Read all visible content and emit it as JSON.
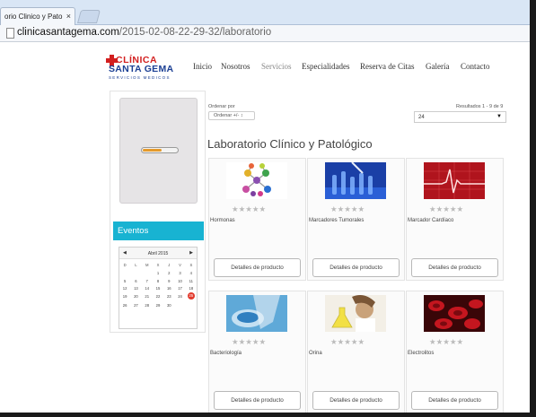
{
  "browser": {
    "tab_title": "orio Clinico y Pato",
    "tab_close": "×",
    "url_host": "clinicasantagema.com",
    "url_path": "/2015-02-08-22-29-32/laboratorio"
  },
  "logo": {
    "line1": "CLÍNICA",
    "line2": "SANTA GEMA",
    "line3": "SERVICIOS MEDICOS",
    "colors": {
      "red": "#d21f1f",
      "blue": "#1b3f94"
    }
  },
  "nav": {
    "items": [
      "Inicio",
      "Nosotros",
      "Servicios",
      "Especialidades",
      "Reserva de Citas",
      "Galería",
      "Contacto"
    ],
    "active": "Servicios"
  },
  "sidebar": {
    "loader_progress": 0.55,
    "events_title": "Eventos",
    "calendar": {
      "month": "Abril 2015",
      "prev": "◀",
      "next": "▶",
      "weekdays": [
        "D",
        "L",
        "M",
        "X",
        "J",
        "V",
        "S"
      ],
      "weeks": [
        [
          "",
          "",
          "",
          "1",
          "2",
          "3",
          "4"
        ],
        [
          "5",
          "6",
          "7",
          "8",
          "9",
          "10",
          "11"
        ],
        [
          "12",
          "13",
          "14",
          "15",
          "16",
          "17",
          "18"
        ],
        [
          "19",
          "20",
          "21",
          "22",
          "23",
          "24",
          "25"
        ],
        [
          "26",
          "27",
          "28",
          "29",
          "30",
          "",
          ""
        ]
      ],
      "today": "25"
    }
  },
  "toolbar": {
    "order_label": "Ordenar por",
    "order_value": "Ordenar +/-",
    "order_icon": "↕",
    "results": "Resultados 1 - 9 de 9",
    "per_page": "24",
    "per_page_arrow": "▼"
  },
  "page_title": "Laboratorio Clínico y Patológico",
  "rating_stars": "★★★★★",
  "products": [
    {
      "name": "Hormonas",
      "button": "Detalles de producto",
      "image": "hormones-molecule"
    },
    {
      "name": "Marcadores Tumorales",
      "button": "Detalles de producto",
      "image": "test-tubes"
    },
    {
      "name": "Marcador Cardíaco",
      "button": "Detalles de producto",
      "image": "heartbeat"
    },
    {
      "name": "Bacteriología",
      "button": "Detalles de producto",
      "image": "petri-dish"
    },
    {
      "name": "Orina",
      "button": "Detalles de producto",
      "image": "scientist-flask"
    },
    {
      "name": "Electrolitos",
      "button": "Detalles de producto",
      "image": "blood-cells"
    }
  ]
}
